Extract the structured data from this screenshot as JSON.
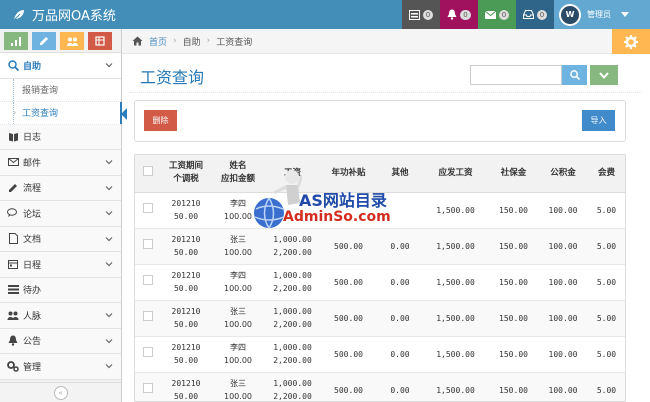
{
  "app": {
    "title": "万品网OA系统"
  },
  "topnav": {
    "items": [
      {
        "icon": "tasks-icon",
        "count": "0",
        "color": "#555555"
      },
      {
        "icon": "bell-icon",
        "count": "0",
        "color": "#a0115e"
      },
      {
        "icon": "envelope-icon",
        "count": "0",
        "color": "#4b9a56"
      },
      {
        "icon": "inbox-icon",
        "count": "0",
        "color": "#2e6589"
      }
    ],
    "user": {
      "avatar_text": "W",
      "label": "管理员"
    }
  },
  "sidebar": {
    "shortcuts": [
      {
        "icon": "signal-icon",
        "color": "#87b87f"
      },
      {
        "icon": "pencil-icon",
        "color": "#6fb3e0"
      },
      {
        "icon": "group-icon",
        "color": "#ffb752"
      },
      {
        "icon": "cogs-icon",
        "color": "#d15b47"
      }
    ],
    "items": [
      {
        "label": "自助",
        "icon": "search-icon"
      },
      {
        "label": "日志",
        "icon": "book-icon"
      },
      {
        "label": "邮件",
        "icon": "envelope-icon"
      },
      {
        "label": "流程",
        "icon": "pencil-icon"
      },
      {
        "label": "论坛",
        "icon": "comments-icon"
      },
      {
        "label": "文档",
        "icon": "file-icon"
      },
      {
        "label": "日程",
        "icon": "calendar-icon"
      },
      {
        "label": "待办",
        "icon": "list-icon"
      },
      {
        "label": "人脉",
        "icon": "group-icon"
      },
      {
        "label": "公告",
        "icon": "bell-icon"
      },
      {
        "label": "管理",
        "icon": "cogs-icon"
      }
    ],
    "submenu": [
      "报销查询",
      "工资查询"
    ],
    "collapse": "«"
  },
  "breadcrumb": {
    "home": "首页",
    "level1": "自助",
    "current": "工资查询"
  },
  "page": {
    "title": "工资查询"
  },
  "search": {
    "placeholder": ""
  },
  "buttons": {
    "delete": "删除",
    "import": "导入"
  },
  "table": {
    "headers": [
      [
        "工资期间",
        "个调税"
      ],
      [
        "姓名",
        "应扣金额"
      ],
      [
        "工资",
        ""
      ],
      [
        "年功补贴",
        ""
      ],
      [
        "其他",
        ""
      ],
      [
        "应发工资",
        ""
      ],
      [
        "社保金",
        ""
      ],
      [
        "公积金",
        ""
      ],
      [
        "会费",
        ""
      ]
    ],
    "rows": [
      {
        "period": "201210",
        "tax": "50.00",
        "name": "李四",
        "deduct": "100.00",
        "salary": "",
        "salary2": "",
        "seniority": "",
        "other": "",
        "gross": "1,500.00",
        "social": "150.00",
        "fund": "100.00",
        "fee": "5.00"
      },
      {
        "period": "201210",
        "tax": "50.00",
        "name": "张三",
        "deduct": "100.00",
        "salary": "1,000.00",
        "salary2": "2,200.00",
        "seniority": "500.00",
        "other": "0.00",
        "gross": "1,500.00",
        "social": "150.00",
        "fund": "100.00",
        "fee": "5.00"
      },
      {
        "period": "201210",
        "tax": "50.00",
        "name": "李四",
        "deduct": "100.00",
        "salary": "1,000.00",
        "salary2": "2,200.00",
        "seniority": "500.00",
        "other": "0.00",
        "gross": "1,500.00",
        "social": "150.00",
        "fund": "100.00",
        "fee": "5.00"
      },
      {
        "period": "201210",
        "tax": "50.00",
        "name": "张三",
        "deduct": "100.00",
        "salary": "1,000.00",
        "salary2": "2,200.00",
        "seniority": "500.00",
        "other": "0.00",
        "gross": "1,500.00",
        "social": "150.00",
        "fund": "100.00",
        "fee": "5.00"
      },
      {
        "period": "201210",
        "tax": "50.00",
        "name": "李四",
        "deduct": "100.00",
        "salary": "1,000.00",
        "salary2": "2,200.00",
        "seniority": "500.00",
        "other": "0.00",
        "gross": "1,500.00",
        "social": "150.00",
        "fund": "100.00",
        "fee": "5.00"
      },
      {
        "period": "201210",
        "tax": "50.00",
        "name": "张三",
        "deduct": "100.00",
        "salary": "1,000.00",
        "salary2": "2,200.00",
        "seniority": "500.00",
        "other": "0.00",
        "gross": "1,500.00",
        "social": "150.00",
        "fund": "100.00",
        "fee": "5.00"
      }
    ]
  },
  "watermark": {
    "line1": "AS网站目录",
    "line2": "AdminSo.com"
  }
}
